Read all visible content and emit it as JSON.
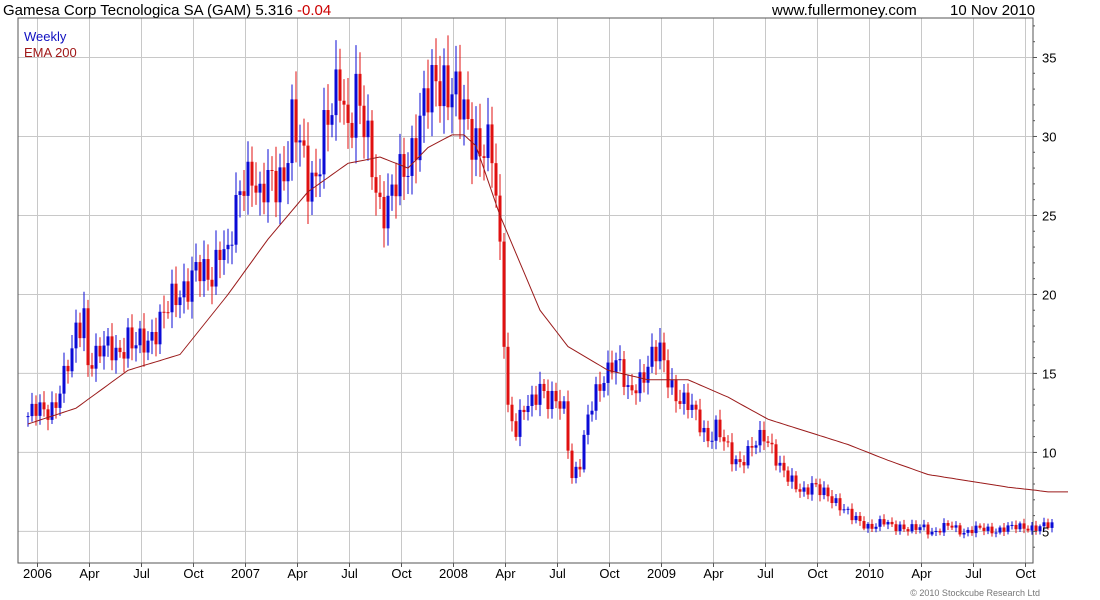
{
  "header": {
    "title_prefix": "Gamesa Corp Tecnologica SA (GAM) 5.316",
    "title_change": "-0.04",
    "website": "www.fullermoney.com",
    "date": "10 Nov 2010"
  },
  "footer": {
    "copyright": "© 2010 Stockcube Research Ltd"
  },
  "colors": {
    "up": "#0b0bd6",
    "down": "#e01010",
    "ema": "#9a1a1a",
    "grid": "#c8c8c8",
    "axis": "#555555"
  },
  "chart_data": {
    "type": "candlestick",
    "title": "Gamesa Corp Tecnologica SA (GAM) 5.316 -0.04",
    "legend": [
      "Weekly",
      "EMA 200"
    ],
    "legend_position": "top-left",
    "grid": true,
    "y_axis_position": "right",
    "ylim": [
      3,
      37.5
    ],
    "y_ticks": [
      5,
      10,
      15,
      20,
      25,
      30,
      35
    ],
    "x_range": [
      "2005-11",
      "2010-11"
    ],
    "x_tick_labels": [
      "2006",
      "Apr",
      "Jul",
      "Oct",
      "2007",
      "Apr",
      "Jul",
      "Oct",
      "2008",
      "Apr",
      "Jul",
      "Oct",
      "2009",
      "Apr",
      "Jul",
      "Oct",
      "2010",
      "Apr",
      "Jul",
      "Oct"
    ],
    "price_weekly": {
      "t": [
        0,
        2,
        4,
        6,
        7,
        9,
        11,
        12,
        14,
        15,
        17,
        19,
        21,
        23,
        25,
        26,
        28,
        30,
        32,
        34,
        36,
        38,
        40,
        42,
        44,
        46,
        48,
        50,
        52,
        54,
        56,
        58,
        60,
        62,
        64,
        66,
        68,
        70,
        72,
        74,
        76,
        78,
        80,
        82,
        84,
        86,
        88,
        90,
        92,
        94,
        96,
        98,
        100,
        102,
        104,
        106,
        108,
        110,
        112,
        114,
        116,
        118,
        120,
        122,
        124,
        126,
        128,
        130,
        132,
        134,
        136,
        138,
        140,
        142,
        144,
        146,
        148,
        150,
        152,
        154,
        156,
        158,
        160,
        162,
        164,
        166,
        168,
        170,
        172,
        174,
        176,
        178,
        180,
        182,
        184,
        186,
        188,
        190,
        192,
        194,
        196,
        198,
        200,
        202,
        204,
        206,
        208,
        210,
        212,
        214,
        216,
        218,
        220,
        222,
        224,
        226,
        228,
        230,
        232,
        234,
        236,
        238,
        240,
        242,
        244,
        246,
        248,
        250,
        252,
        254,
        256,
        258,
        260
      ],
      "close": [
        12.3,
        12.5,
        12.6,
        13.0,
        13.4,
        14.6,
        16.0,
        17.7,
        19.0,
        16.0,
        15.8,
        16.4,
        16.8,
        16.6,
        17.0,
        16.4,
        16.9,
        17.4,
        17.9,
        18.4,
        19.5,
        20.5,
        20.8,
        21.2,
        21.0,
        21.5,
        23.5,
        22.0,
        25.0,
        27.8,
        28.2,
        25.5,
        26.8,
        27.5,
        28.1,
        30.5,
        29.0,
        27.5,
        28.0,
        30.0,
        31.0,
        34.0,
        31.0,
        32.5,
        30.0,
        28.5,
        26.0,
        25.5,
        26.5,
        28.0,
        29.5,
        31.0,
        32.0,
        33.5,
        34.0,
        33.0,
        31.5,
        30.5,
        30.2,
        29.5,
        28.5,
        22.5,
        13.0,
        11.5,
        12.5,
        13.0,
        14.5,
        13.5,
        13.0,
        12.5,
        8.6,
        9.5,
        12.0,
        13.5,
        15.0,
        16.0,
        15.2,
        13.5,
        14.5,
        15.2,
        15.8,
        16.2,
        15.0,
        13.8,
        13.0,
        12.6,
        12.0,
        11.0,
        11.4,
        10.5,
        9.8,
        9.5,
        9.9,
        10.4,
        11.2,
        10.5,
        9.0,
        8.2,
        7.9,
        7.7,
        7.9,
        7.4,
        7.3,
        7.0,
        6.4,
        5.8,
        5.6,
        5.4,
        5.4,
        5.5,
        5.3,
        5.4,
        5.2,
        5.1,
        5.2,
        5.0,
        5.2,
        5.3,
        5.1,
        5.0,
        5.2,
        5.1,
        5.0,
        5.1,
        5.3,
        5.2,
        5.2,
        5.3,
        5.3,
        5.3,
        5.3
      ]
    },
    "ema_200": {
      "t": [
        0,
        12,
        25,
        38,
        50,
        60,
        70,
        80,
        88,
        95,
        100,
        106,
        109,
        112,
        118,
        128,
        135,
        145,
        155,
        165,
        175,
        185,
        195,
        205,
        215,
        225,
        235,
        245,
        252,
        255,
        260
      ],
      "values": [
        11.8,
        12.8,
        15.2,
        16.2,
        20.0,
        23.5,
        26.5,
        28.3,
        28.7,
        28.0,
        29.3,
        30.1,
        30.1,
        29.4,
        25.0,
        19.0,
        16.7,
        15.2,
        14.6,
        14.6,
        13.5,
        12.1,
        11.3,
        10.5,
        9.5,
        8.6,
        8.2,
        7.8,
        7.6,
        7.5,
        7.5
      ]
    }
  }
}
